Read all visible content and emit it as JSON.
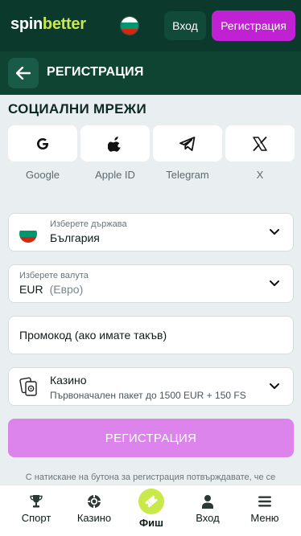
{
  "header": {
    "logo_spin": "spin",
    "logo_better": "better",
    "login_label": "Вход",
    "register_label": "Регистрация"
  },
  "titlebar": {
    "title": "РЕГИСТРАЦИЯ"
  },
  "social": {
    "title": "СОЦИАЛНИ МРЕЖИ",
    "providers": [
      {
        "label": "Google",
        "icon": "google-icon"
      },
      {
        "label": "Apple ID",
        "icon": "apple-icon"
      },
      {
        "label": "Telegram",
        "icon": "telegram-icon"
      },
      {
        "label": "X",
        "icon": "x-icon"
      }
    ]
  },
  "form": {
    "country": {
      "label": "Изберете държава",
      "value": "България"
    },
    "currency": {
      "label": "Изберете валута",
      "code": "EUR",
      "name": "(Евро)"
    },
    "promo": {
      "placeholder": "Промокод (ако имате такъв)"
    },
    "bonus": {
      "title": "Казино",
      "description": "Първоначален пакет до 1500 EUR + 150 FS"
    },
    "submit_label": "РЕГИСТРАЦИЯ",
    "terms_text": "С натискане на бутона за регистрация потвърждавате, че се"
  },
  "bottom_nav": {
    "items": [
      {
        "label": "Спорт",
        "icon": "trophy-icon"
      },
      {
        "label": "Казино",
        "icon": "casino-chip-icon"
      },
      {
        "label": "Фиш",
        "icon": "ticket-icon"
      },
      {
        "label": "Вход",
        "icon": "user-icon"
      },
      {
        "label": "Меню",
        "icon": "menu-icon"
      }
    ]
  },
  "colors": {
    "header_bg": "#0b3a2c",
    "titlebar_bg": "#0f4433",
    "brand_lime": "#c9e84a",
    "register_purple": "#c021d3",
    "submit_pink": "#dc83ec",
    "page_bg": "#e9eef0"
  }
}
